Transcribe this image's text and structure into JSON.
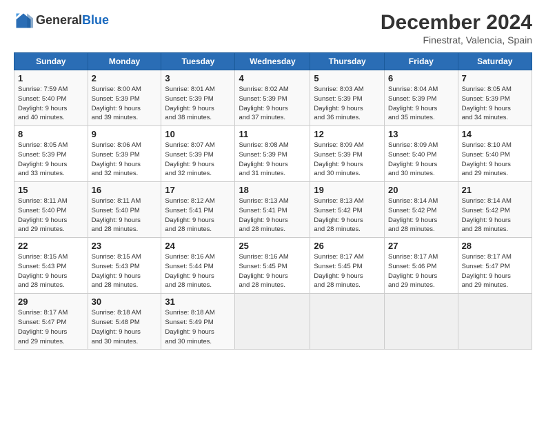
{
  "header": {
    "logo_general": "General",
    "logo_blue": "Blue",
    "title": "December 2024",
    "location": "Finestrat, Valencia, Spain"
  },
  "days_of_week": [
    "Sunday",
    "Monday",
    "Tuesday",
    "Wednesday",
    "Thursday",
    "Friday",
    "Saturday"
  ],
  "weeks": [
    [
      {
        "day": "1",
        "info": "Sunrise: 7:59 AM\nSunset: 5:40 PM\nDaylight: 9 hours\nand 40 minutes."
      },
      {
        "day": "2",
        "info": "Sunrise: 8:00 AM\nSunset: 5:39 PM\nDaylight: 9 hours\nand 39 minutes."
      },
      {
        "day": "3",
        "info": "Sunrise: 8:01 AM\nSunset: 5:39 PM\nDaylight: 9 hours\nand 38 minutes."
      },
      {
        "day": "4",
        "info": "Sunrise: 8:02 AM\nSunset: 5:39 PM\nDaylight: 9 hours\nand 37 minutes."
      },
      {
        "day": "5",
        "info": "Sunrise: 8:03 AM\nSunset: 5:39 PM\nDaylight: 9 hours\nand 36 minutes."
      },
      {
        "day": "6",
        "info": "Sunrise: 8:04 AM\nSunset: 5:39 PM\nDaylight: 9 hours\nand 35 minutes."
      },
      {
        "day": "7",
        "info": "Sunrise: 8:05 AM\nSunset: 5:39 PM\nDaylight: 9 hours\nand 34 minutes."
      }
    ],
    [
      {
        "day": "8",
        "info": "Sunrise: 8:05 AM\nSunset: 5:39 PM\nDaylight: 9 hours\nand 33 minutes."
      },
      {
        "day": "9",
        "info": "Sunrise: 8:06 AM\nSunset: 5:39 PM\nDaylight: 9 hours\nand 32 minutes."
      },
      {
        "day": "10",
        "info": "Sunrise: 8:07 AM\nSunset: 5:39 PM\nDaylight: 9 hours\nand 32 minutes."
      },
      {
        "day": "11",
        "info": "Sunrise: 8:08 AM\nSunset: 5:39 PM\nDaylight: 9 hours\nand 31 minutes."
      },
      {
        "day": "12",
        "info": "Sunrise: 8:09 AM\nSunset: 5:39 PM\nDaylight: 9 hours\nand 30 minutes."
      },
      {
        "day": "13",
        "info": "Sunrise: 8:09 AM\nSunset: 5:40 PM\nDaylight: 9 hours\nand 30 minutes."
      },
      {
        "day": "14",
        "info": "Sunrise: 8:10 AM\nSunset: 5:40 PM\nDaylight: 9 hours\nand 29 minutes."
      }
    ],
    [
      {
        "day": "15",
        "info": "Sunrise: 8:11 AM\nSunset: 5:40 PM\nDaylight: 9 hours\nand 29 minutes."
      },
      {
        "day": "16",
        "info": "Sunrise: 8:11 AM\nSunset: 5:40 PM\nDaylight: 9 hours\nand 28 minutes."
      },
      {
        "day": "17",
        "info": "Sunrise: 8:12 AM\nSunset: 5:41 PM\nDaylight: 9 hours\nand 28 minutes."
      },
      {
        "day": "18",
        "info": "Sunrise: 8:13 AM\nSunset: 5:41 PM\nDaylight: 9 hours\nand 28 minutes."
      },
      {
        "day": "19",
        "info": "Sunrise: 8:13 AM\nSunset: 5:42 PM\nDaylight: 9 hours\nand 28 minutes."
      },
      {
        "day": "20",
        "info": "Sunrise: 8:14 AM\nSunset: 5:42 PM\nDaylight: 9 hours\nand 28 minutes."
      },
      {
        "day": "21",
        "info": "Sunrise: 8:14 AM\nSunset: 5:42 PM\nDaylight: 9 hours\nand 28 minutes."
      }
    ],
    [
      {
        "day": "22",
        "info": "Sunrise: 8:15 AM\nSunset: 5:43 PM\nDaylight: 9 hours\nand 28 minutes."
      },
      {
        "day": "23",
        "info": "Sunrise: 8:15 AM\nSunset: 5:43 PM\nDaylight: 9 hours\nand 28 minutes."
      },
      {
        "day": "24",
        "info": "Sunrise: 8:16 AM\nSunset: 5:44 PM\nDaylight: 9 hours\nand 28 minutes."
      },
      {
        "day": "25",
        "info": "Sunrise: 8:16 AM\nSunset: 5:45 PM\nDaylight: 9 hours\nand 28 minutes."
      },
      {
        "day": "26",
        "info": "Sunrise: 8:17 AM\nSunset: 5:45 PM\nDaylight: 9 hours\nand 28 minutes."
      },
      {
        "day": "27",
        "info": "Sunrise: 8:17 AM\nSunset: 5:46 PM\nDaylight: 9 hours\nand 29 minutes."
      },
      {
        "day": "28",
        "info": "Sunrise: 8:17 AM\nSunset: 5:47 PM\nDaylight: 9 hours\nand 29 minutes."
      }
    ],
    [
      {
        "day": "29",
        "info": "Sunrise: 8:17 AM\nSunset: 5:47 PM\nDaylight: 9 hours\nand 29 minutes."
      },
      {
        "day": "30",
        "info": "Sunrise: 8:18 AM\nSunset: 5:48 PM\nDaylight: 9 hours\nand 30 minutes."
      },
      {
        "day": "31",
        "info": "Sunrise: 8:18 AM\nSunset: 5:49 PM\nDaylight: 9 hours\nand 30 minutes."
      },
      {
        "day": "",
        "info": ""
      },
      {
        "day": "",
        "info": ""
      },
      {
        "day": "",
        "info": ""
      },
      {
        "day": "",
        "info": ""
      }
    ]
  ]
}
